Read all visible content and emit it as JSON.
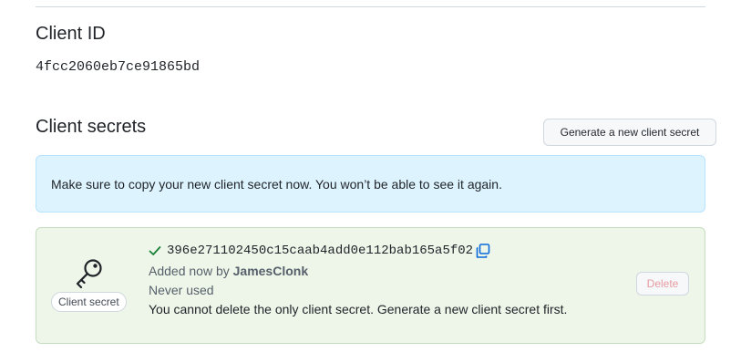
{
  "client_id": {
    "title": "Client ID",
    "value": "4fcc2060eb7ce91865bd"
  },
  "client_secrets": {
    "title": "Client secrets",
    "generate_button_label": "Generate a new client secret",
    "flash_message": "Make sure to copy your new client secret now. You won’t be able to see it again.",
    "secret": {
      "key_label": "Client secret",
      "value": "396e271102450c15caab4add0e112bab165a5f02",
      "added_prefix": "Added now by ",
      "added_by": "JamesClonk",
      "usage": "Never used",
      "warning": "You cannot delete the only client secret. Generate a new client secret first.",
      "delete_label": "Delete",
      "delete_disabled": true
    }
  },
  "icons": {
    "key": "key-icon",
    "check": "check-icon",
    "copy": "copy-icon"
  },
  "colors": {
    "flash_bg": "#ddf4ff",
    "secret_bg": "#eef6ea",
    "check": "#1a7f37",
    "copy": "#0969da",
    "delete_disabled": "#e79ba0"
  }
}
